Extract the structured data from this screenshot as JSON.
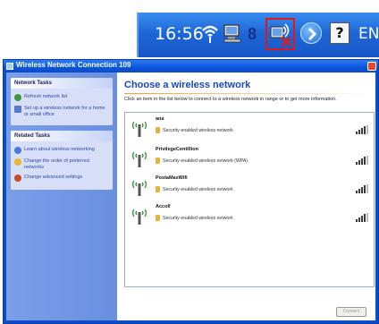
{
  "taskbar": {
    "clock": "16:56",
    "language": "EN",
    "help_glyph": "?",
    "icons": [
      "wifi-icon",
      "network-icon",
      "security-shield-icon",
      "wireless-disconnected-icon",
      "chevron-right-icon",
      "help-icon"
    ],
    "highlight_color": "#e01818"
  },
  "window": {
    "title": "Wireless Network Connection 109",
    "sidebar": {
      "network_tasks": {
        "header": "Network Tasks",
        "items": [
          {
            "label": "Refresh network list",
            "icon": "refresh-icon"
          },
          {
            "label": "Set up a wireless network for a home or small office",
            "icon": "setup-icon"
          }
        ]
      },
      "related_tasks": {
        "header": "Related Tasks",
        "items": [
          {
            "label": "Learn about wireless networking",
            "icon": "info-icon"
          },
          {
            "label": "Change the order of preferred networks",
            "icon": "star-icon"
          },
          {
            "label": "Change advanced settings",
            "icon": "settings-icon"
          }
        ]
      }
    },
    "main": {
      "heading": "Choose a wireless network",
      "instruction": "Click an item in the list below to connect to a wireless network in range or to get more information.",
      "networks": [
        {
          "ssid": "ana",
          "security": "Security-enabled wireless network",
          "signal": 0.8
        },
        {
          "ssid": "PrivilegeCentillion",
          "security": "Security-enabled wireless network (WPA)",
          "signal": 0.8
        },
        {
          "ssid": "PostaMaxWifi",
          "security": "Security-enabled wireless network",
          "signal": 0.8
        },
        {
          "ssid": "Accoll",
          "security": "Security-enabled wireless network",
          "signal": 0.8
        }
      ],
      "connect_label": "Connect"
    }
  }
}
